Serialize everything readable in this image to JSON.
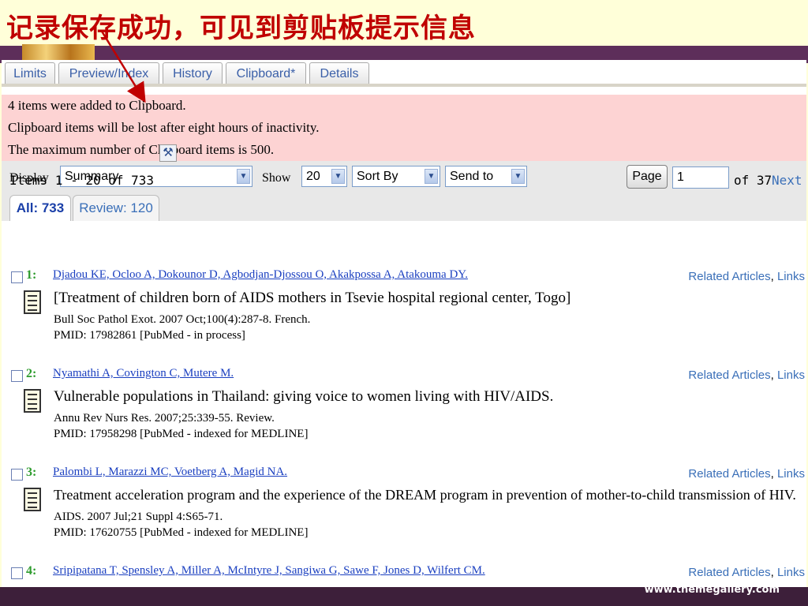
{
  "slide": {
    "title": "记录保存成功，可见到剪贴板提示信息",
    "footer_url": "www.themegallery.com"
  },
  "tabs": [
    "Limits",
    "Preview/Index",
    "History",
    "Clipboard*",
    "Details"
  ],
  "message": {
    "lines": [
      "4 items were added to Clipboard.",
      "Clipboard items will be lost after eight hours of inactivity.",
      "The maximum number of Clipboard items is 500."
    ]
  },
  "toolbar": {
    "display_label": "Display",
    "display_value": "Summary",
    "show_label": "Show",
    "show_value": "20",
    "sort_value": "Sort By",
    "send_value": "Send to"
  },
  "subtabs": {
    "all": "All: 733",
    "review": "Review: 120"
  },
  "paging": {
    "items_text": "Items 1 - 20 of 733",
    "page_button": "Page",
    "page_value": "1",
    "of_pages": "of 37",
    "next": "Next"
  },
  "related_label": "Related Articles",
  "links_label": "Links",
  "separator": ",",
  "records": [
    {
      "num": "1:",
      "authors": "Djadou KE, Ocloo A, Dokounor D, Agbodjan-Djossou O, Akakpossa A, Atakouma DY.",
      "title": "[Treatment of children born of AIDS mothers in Tsevie hospital regional center, Togo]",
      "journal": "Bull Soc Pathol Exot. 2007 Oct;100(4):287-8. French.",
      "pmid": "PMID: 17982861 [PubMed - in process]"
    },
    {
      "num": "2:",
      "authors": "Nyamathi A, Covington C, Mutere M.",
      "title": "Vulnerable populations in Thailand: giving voice to women living with HIV/AIDS.",
      "journal": "Annu Rev Nurs Res. 2007;25:339-55. Review.",
      "pmid": "PMID: 17958298 [PubMed - indexed for MEDLINE]"
    },
    {
      "num": "3:",
      "authors": "Palombi L, Marazzi MC, Voetberg A, Magid NA.",
      "title": "Treatment acceleration program and the experience of the DREAM program in prevention of mother-to-child transmission of HIV.",
      "journal": "AIDS. 2007 Jul;21 Suppl 4:S65-71.",
      "pmid": "PMID: 17620755 [PubMed - indexed for MEDLINE]"
    },
    {
      "num": "4:",
      "authors": "Sripipatana T, Spensley A, Miller A, McIntyre J, Sangiwa G, Sawe F, Jones D, Wilfert CM.",
      "title": "",
      "journal": "",
      "pmid": ""
    }
  ],
  "colors": {
    "title_red": "#c00000",
    "message_bg": "#fdd3d3",
    "link_blue": "#1a3fc0",
    "record_number_green": "#2e9c2e",
    "slide_bg": "#ffffd9",
    "band_purple": "#5d2e5a"
  }
}
